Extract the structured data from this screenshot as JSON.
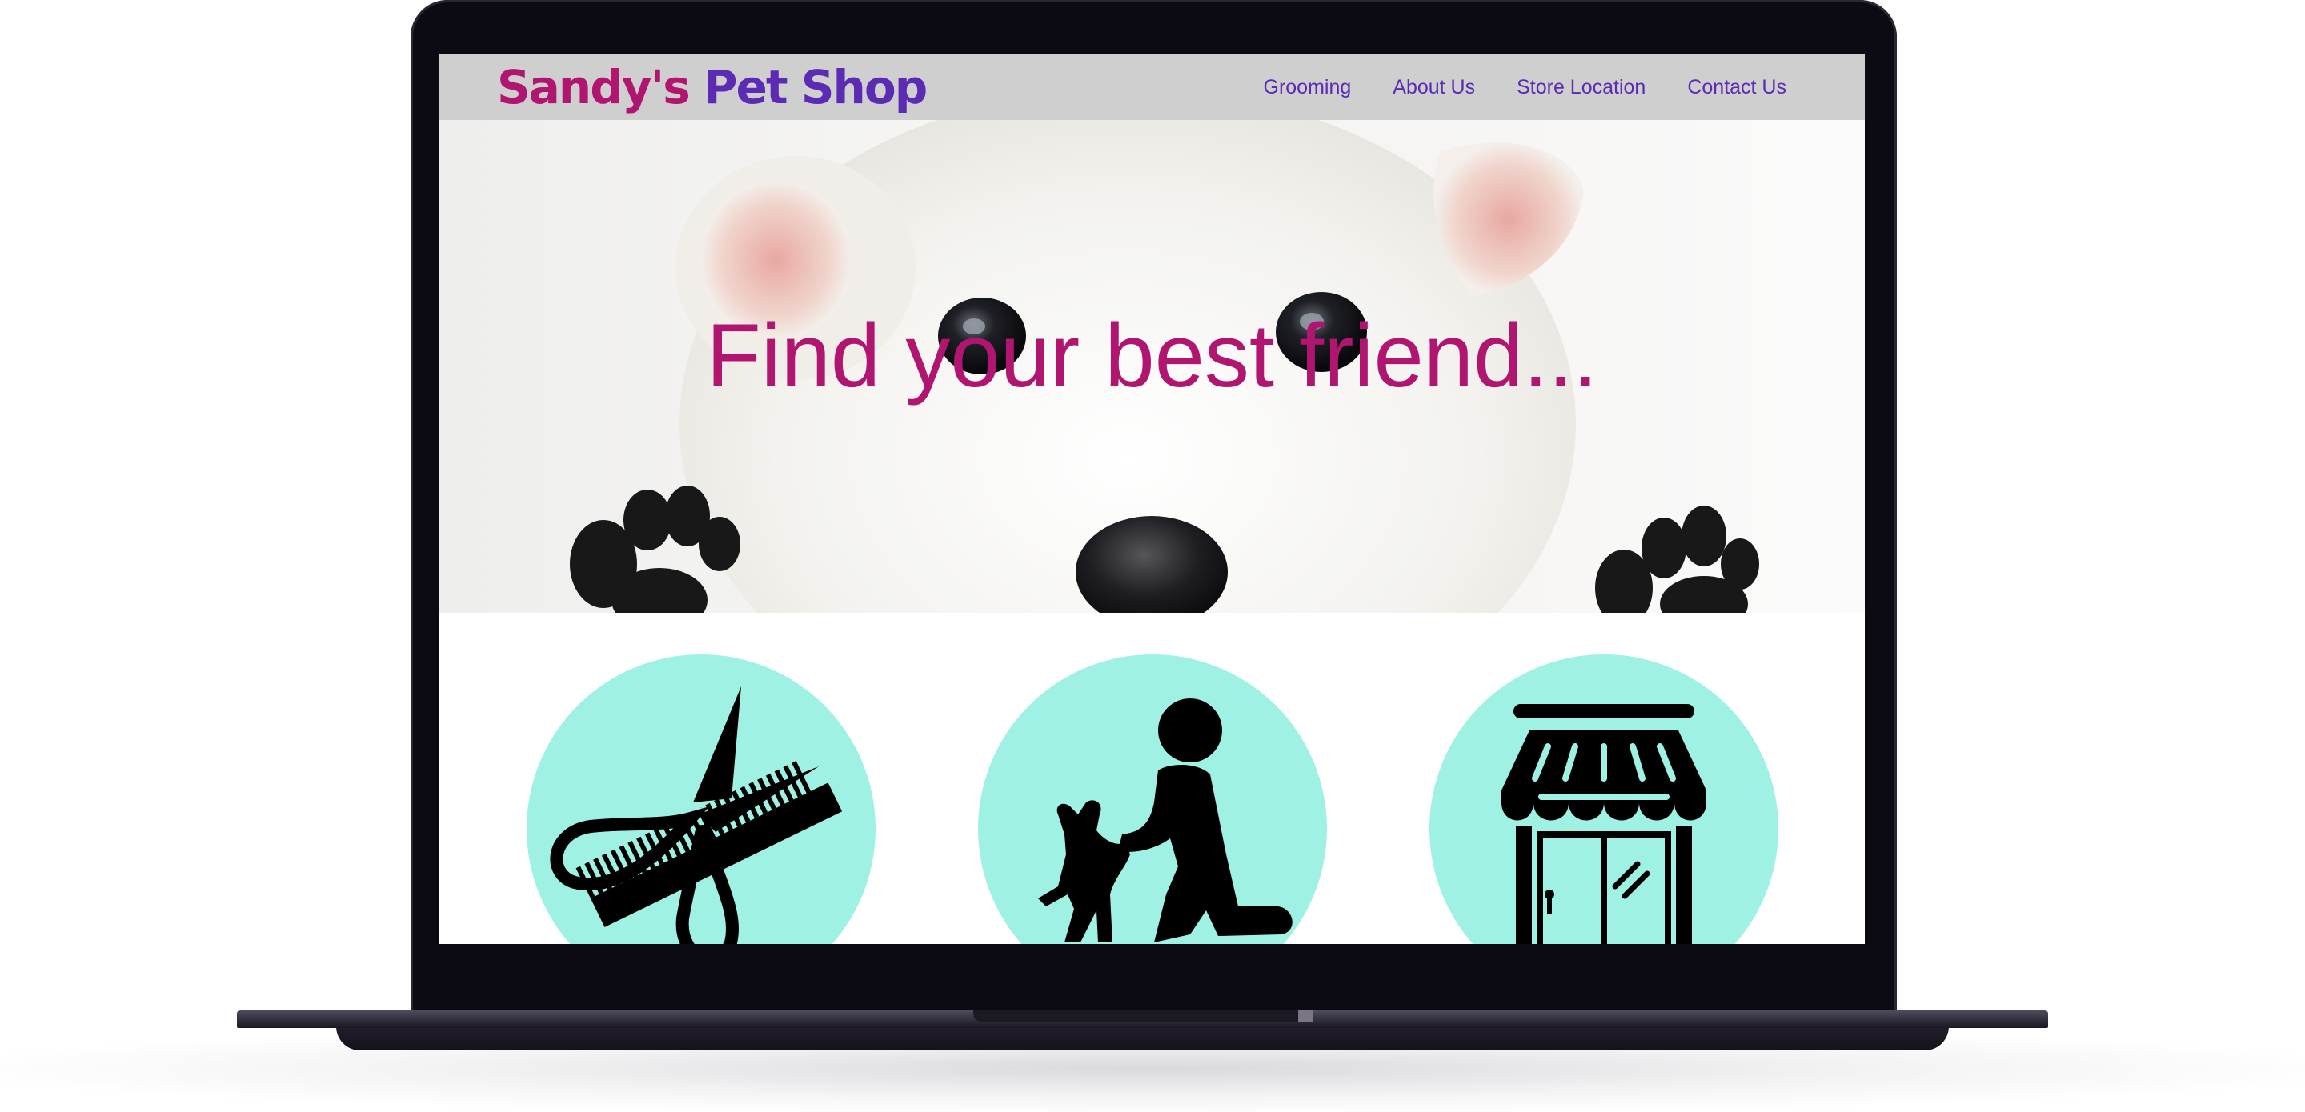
{
  "site": {
    "logo_part1": "Sandy's",
    "logo_part2": "Pet Shop",
    "nav": [
      "Grooming",
      "About Us",
      "Store Location",
      "Contact Us"
    ],
    "hero_heading": "Find your best friend..."
  },
  "services": [
    {
      "icon": "scissors-comb-icon"
    },
    {
      "icon": "person-with-dog-icon"
    },
    {
      "icon": "storefront-icon"
    }
  ],
  "colors": {
    "brand_magenta": "#b0166f",
    "brand_purple": "#5b2bb3",
    "nav_background": "#cfcfcf",
    "circle_teal": "#9ff1e4"
  }
}
